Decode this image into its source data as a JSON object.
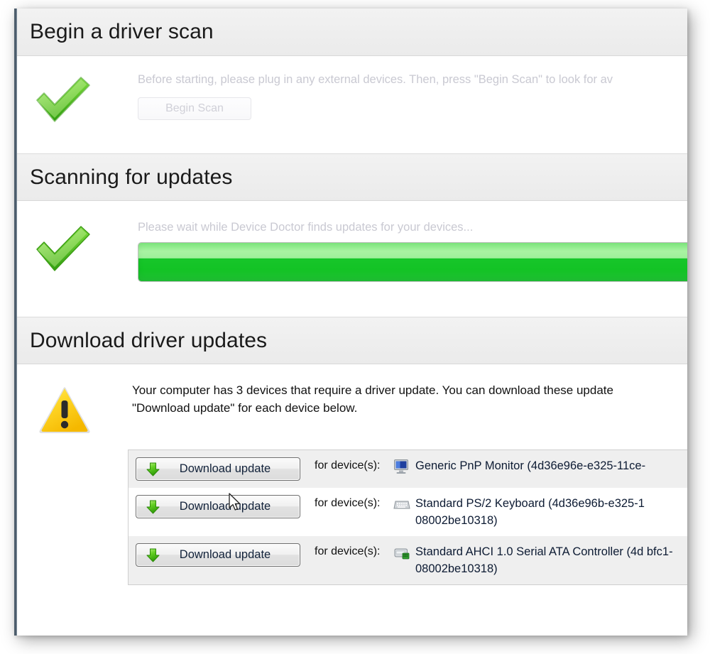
{
  "app": {
    "name": "Device Doctor"
  },
  "sections": [
    {
      "id": "begin-scan",
      "title": "Begin a driver scan",
      "status_icon": "green-check-icon",
      "description": "Before starting, please plug in any external devices. Then, press \"Begin Scan\" to look for av",
      "button_label": "Begin Scan"
    },
    {
      "id": "scanning",
      "title": "Scanning for updates",
      "status_icon": "green-check-icon",
      "description": "Please wait while Device Doctor finds updates for your devices...",
      "progress_percent": 100
    },
    {
      "id": "download",
      "title": "Download driver updates",
      "status_icon": "warning-triangle-icon",
      "description_line1": "Your computer has 3 devices that require a driver update. You can download these update",
      "description_line2": "\"Download update\" for each device below."
    }
  ],
  "device_table": {
    "for_device_label": "for device(s):",
    "download_button_label": "Download update",
    "rows": [
      {
        "icon": "monitor-icon",
        "name": "Generic PnP Monitor (4d36e96e-e325-11ce-",
        "shaded": true
      },
      {
        "icon": "keyboard-icon",
        "name": "Standard PS/2 Keyboard (4d36e96b-e325-1 08002be10318)",
        "shaded": false
      },
      {
        "icon": "storage-controller-icon",
        "name": "Standard AHCI 1.0 Serial ATA Controller (4d bfc1-08002be10318)",
        "shaded": true
      }
    ]
  },
  "colors": {
    "accent_green": "#18c32a",
    "header_band": "#eeeeee",
    "warning_yellow": "#ffcc00",
    "faded_text": "#c9c9d2",
    "body_text": "#111111"
  },
  "cursor": {
    "type": "arrow-pointer"
  }
}
